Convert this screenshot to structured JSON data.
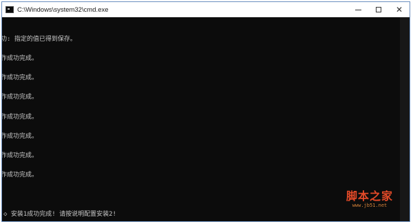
{
  "window": {
    "title": "C:\\Windows\\system32\\cmd.exe",
    "icon": "console-icon",
    "controls": {
      "minimize": "minimize-icon",
      "maximize": "maximize-icon",
      "close": "✕"
    }
  },
  "console": {
    "lines": [
      "功: 指定的值已得到保存。",
      "作成功完成。",
      "作成功完成。",
      "作成功完成。",
      "作成功完成。",
      "作成功完成。",
      "作成功完成。",
      "作成功完成。"
    ],
    "message": "安装1成功完成! 请按说明配置安装2!",
    "prompt_glyph": "◇"
  },
  "watermark": {
    "name": "脚本之家",
    "url": "www.jb51.net"
  },
  "colors": {
    "console_bg": "#0c0c0c",
    "console_text": "#c8c8c8",
    "watermark": "#e34a28"
  }
}
